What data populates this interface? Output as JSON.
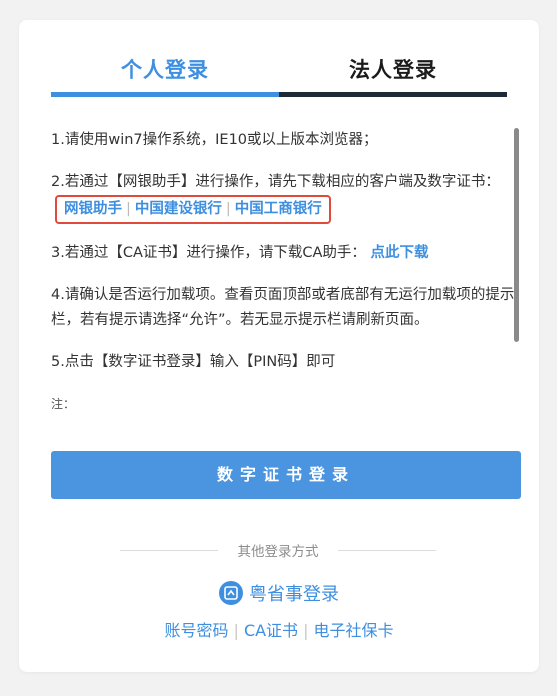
{
  "tabs": [
    {
      "label": "个人登录",
      "active": true
    },
    {
      "label": "法人登录",
      "active": false
    }
  ],
  "instructions": {
    "item1": "1.请使用win7操作系统，IE10或以上版本浏览器；",
    "item2_text": "2.若通过【网银助手】进行操作，请先下载相应的客户端及数字证书：",
    "item2_links": [
      "网银助手",
      "中国建设银行",
      "中国工商银行"
    ],
    "link_separator": "|",
    "item3_text": "3.若通过【CA证书】进行操作，请下载CA助手：",
    "item3_link": "点此下载",
    "item4": "4.请确认是否运行加载项。查看页面顶部或者底部有无运行加载项的提示栏，若有提示请选择“允许”。若无显示提示栏请刷新页面。",
    "item5": "5.点击【数字证书登录】输入【PIN码】即可",
    "note": "注："
  },
  "login_button": "数字证书登录",
  "other_methods_label": "其他登录方式",
  "yss_login": {
    "label": "粤省事登录",
    "icon": "yss-app-icon"
  },
  "alt_logins": [
    "账号密码",
    "CA证书",
    "电子社保卡"
  ],
  "alt_separator": "|",
  "colors": {
    "accent": "#3e8fe0",
    "button": "#4a94e0",
    "highlight_border": "#e04a3a",
    "inactive_tab_bar": "#1e2a36"
  }
}
